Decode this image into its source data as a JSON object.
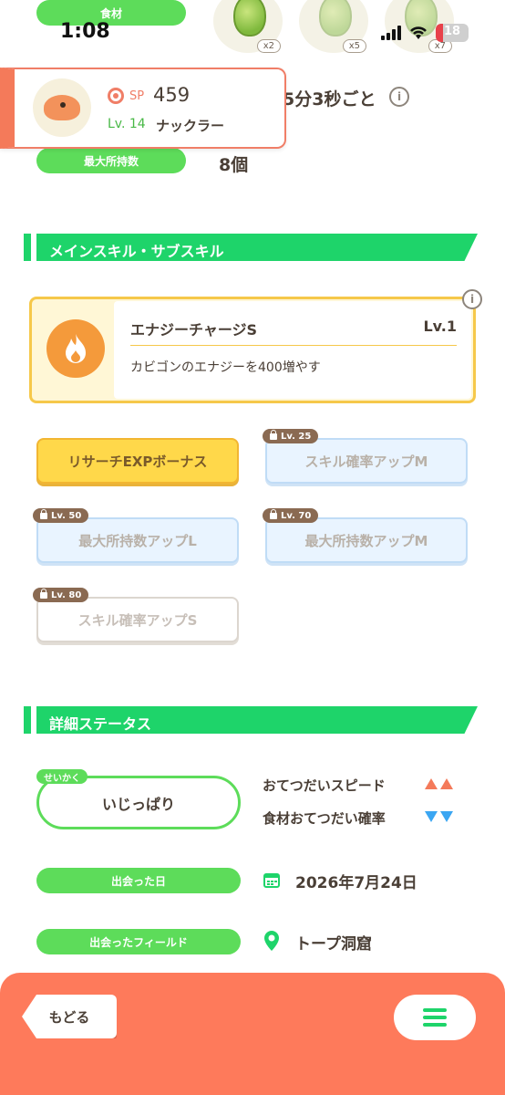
{
  "status_bar": {
    "time": "1:08",
    "battery": "18"
  },
  "ingredients": {
    "label": "食材",
    "items": [
      {
        "count": "x2"
      },
      {
        "count": "x5"
      },
      {
        "count": "x7"
      }
    ]
  },
  "pokemon": {
    "sp_label": "SP",
    "sp_value": "459",
    "level": "Lv. 14",
    "name": "ナックラー"
  },
  "help_frequency": {
    "value": "5分3秒ごと"
  },
  "max_holding": {
    "label": "最大所持数",
    "value": "8個"
  },
  "skills_section": {
    "title": "メインスキル・サブスキル",
    "main_skill": {
      "name": "エナジーチャージS",
      "level": "Lv.1",
      "description": "カビゴンのエナジーを400増やす"
    },
    "sub_skills": [
      {
        "label": "リサーチEXPボーナス",
        "lock": ""
      },
      {
        "label": "スキル確率アップM",
        "lock": "Lv. 25"
      },
      {
        "label": "最大所持数アップL",
        "lock": "Lv. 50"
      },
      {
        "label": "最大所持数アップM",
        "lock": "Lv. 70"
      },
      {
        "label": "スキル確率アップS",
        "lock": "Lv. 80"
      }
    ]
  },
  "status_section": {
    "title": "詳細ステータス",
    "nature_tag": "せいかく",
    "nature": "いじっぱり",
    "nature_up": "おてつだいスピード",
    "nature_down": "食材おてつだい確率",
    "met_date_label": "出会った日",
    "met_date": "2026年7月24日",
    "met_field_label": "出会ったフィールド",
    "met_field": "トープ洞窟"
  },
  "bottom_bar": {
    "back_label": "もどる"
  },
  "colors": {
    "accent_green": "#1ed46a",
    "pill_green": "#5ddc5a",
    "bottom_bar": "#fe7a5b",
    "gold": "#ffd84a",
    "up_arrow": "#f47a5a",
    "down_arrow": "#3ba6f2"
  },
  "icons": [
    "info-icon",
    "fire-icon",
    "lock-icon",
    "calendar-icon",
    "map-pin-icon",
    "menu-icon",
    "pokeball-icon"
  ]
}
